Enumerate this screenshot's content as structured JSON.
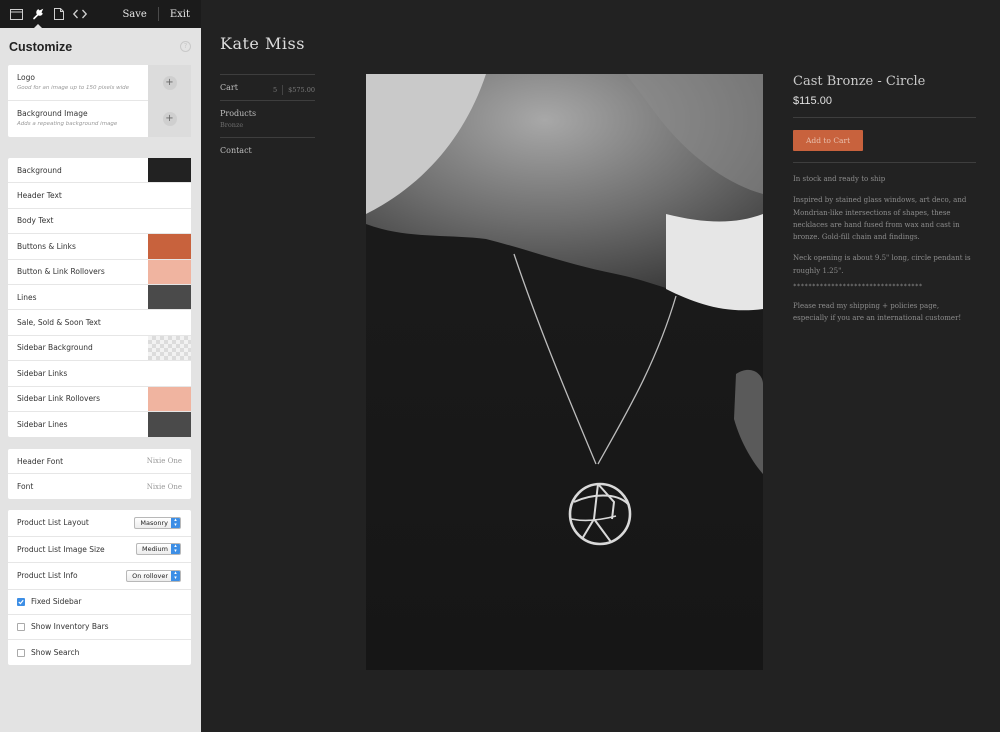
{
  "topbar": {
    "icons": [
      "window-icon",
      "wrench-icon",
      "document-icon",
      "code-icon"
    ],
    "save_label": "Save",
    "exit_label": "Exit"
  },
  "customize": {
    "title": "Customize",
    "help": "?",
    "images": [
      {
        "label": "Logo",
        "hint": "Good for an image up to 150 pixels wide"
      },
      {
        "label": "Background Image",
        "hint": "Adds a repeating background image"
      }
    ],
    "colors": [
      {
        "label": "Background",
        "color": "#222222"
      },
      {
        "label": "Header Text",
        "color": "#ffffff"
      },
      {
        "label": "Body Text",
        "color": "#ffffff"
      },
      {
        "label": "Buttons & Links",
        "color": "#c8623d"
      },
      {
        "label": "Button & Link Rollovers",
        "color": "#f0b4a0"
      },
      {
        "label": "Lines",
        "color": "#4a4a4a"
      },
      {
        "label": "Sale, Sold & Soon Text",
        "color": "#ffffff"
      },
      {
        "label": "Sidebar Background",
        "color": "transparent"
      },
      {
        "label": "Sidebar Links",
        "color": "#ffffff"
      },
      {
        "label": "Sidebar Link Rollovers",
        "color": "#f0b4a0"
      },
      {
        "label": "Sidebar Lines",
        "color": "#4a4a4a"
      }
    ],
    "fonts": [
      {
        "label": "Header Font",
        "value": "Nixie One"
      },
      {
        "label": "Font",
        "value": "Nixie One"
      }
    ],
    "options": [
      {
        "label": "Product List Layout",
        "value": "Masonry"
      },
      {
        "label": "Product List Image Size",
        "value": "Medium"
      },
      {
        "label": "Product List Info",
        "value": "On rollover"
      }
    ],
    "checkboxes": [
      {
        "label": "Fixed Sidebar",
        "checked": true
      },
      {
        "label": "Show Inventory Bars",
        "checked": false
      },
      {
        "label": "Show Search",
        "checked": false
      }
    ]
  },
  "store": {
    "name": "Kate Miss",
    "nav": {
      "cart_label": "Cart",
      "cart_count": "5",
      "cart_total": "$575.00",
      "products_label": "Products",
      "products_sub": "Bronze",
      "contact_label": "Contact"
    },
    "product": {
      "title": "Cast Bronze - Circle",
      "price": "$115.00",
      "add_button": "Add to Cart",
      "stock": "In stock and ready to ship",
      "description": "Inspired by stained glass windows, art deco, and Mondrian-like intersections of shapes, these necklaces are hand fused from wax and cast in bronze. Gold-fill chain and findings.",
      "size_note": "Neck opening is about 9.5\" long, circle pendant is roughly 1.25\".",
      "divider": "**********************************",
      "shipping_note": "Please read my shipping + policies page, especially if you are an international customer!"
    }
  }
}
